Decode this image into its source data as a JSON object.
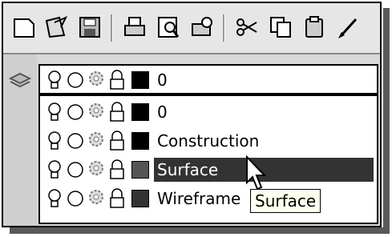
{
  "toolbar": {
    "buttons": [
      {
        "id": "new",
        "icon": "new-document-icon"
      },
      {
        "id": "open",
        "icon": "open-icon"
      },
      {
        "id": "save",
        "icon": "save-icon"
      },
      {
        "id": "print",
        "icon": "printer-icon"
      },
      {
        "id": "preview",
        "icon": "print-preview-icon"
      },
      {
        "id": "publish",
        "icon": "publish-icon"
      },
      {
        "id": "cut",
        "icon": "scissors-icon"
      },
      {
        "id": "copy",
        "icon": "copy-icon"
      },
      {
        "id": "paste",
        "icon": "paste-icon"
      },
      {
        "id": "match",
        "icon": "brush-icon"
      }
    ]
  },
  "layer_combo": {
    "current": {
      "name": "0",
      "color": "#000000"
    },
    "items": [
      {
        "name": "0",
        "color": "#000000",
        "selected": false
      },
      {
        "name": "Construction",
        "color": "#000000",
        "selected": false
      },
      {
        "name": "Surface",
        "color": "#555555",
        "selected": true
      },
      {
        "name": "Wireframe",
        "color": "#333333",
        "selected": false
      }
    ]
  },
  "tooltip": {
    "text": "Surface"
  },
  "colors": {
    "highlight": "#333333",
    "tooltip_bg": "#fffff0"
  }
}
